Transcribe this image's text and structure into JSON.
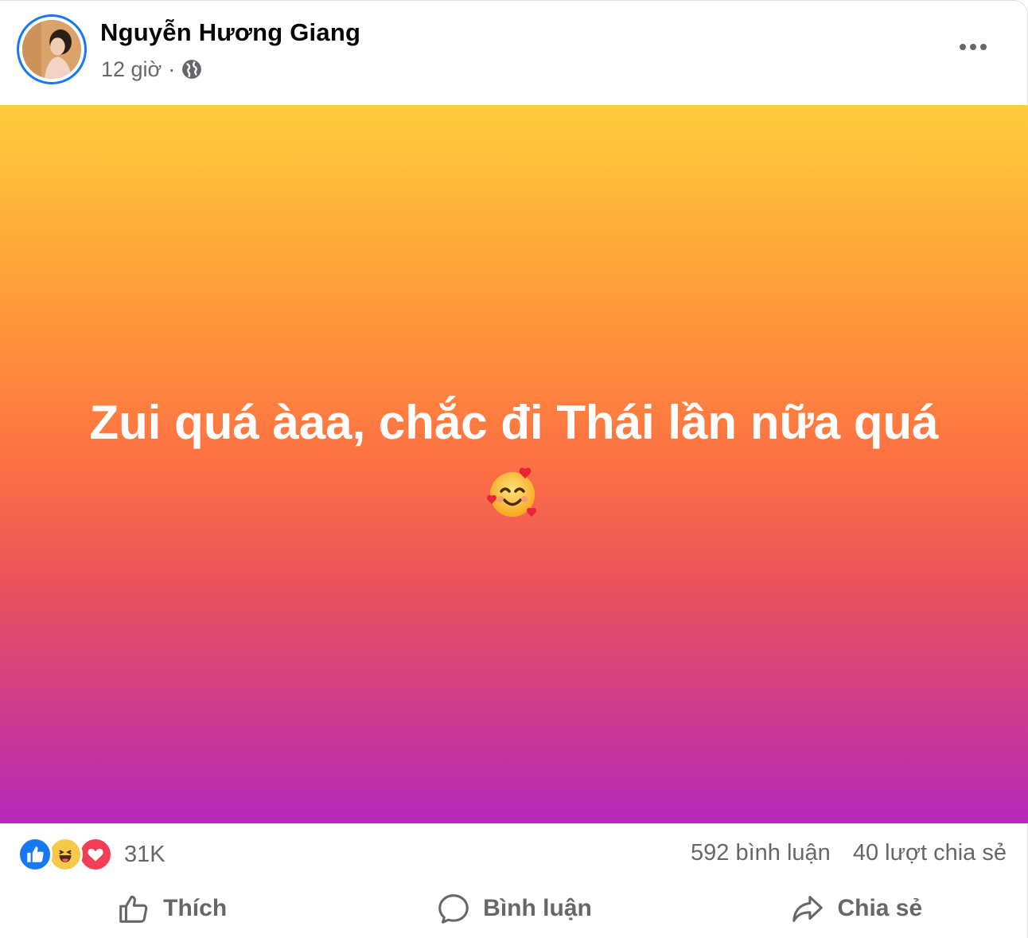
{
  "post": {
    "author": "Nguyễn Hương Giang",
    "time": "12 giờ",
    "separator": "·",
    "privacy_icon": "globe-icon",
    "more_icon": "more-options-icon",
    "text": "Zui quá àaa, chắc đi Thái lần nữa quá",
    "emoji_name": "smiling-face-with-hearts",
    "background_gradient": [
      "#ffcd3c",
      "#fd7043",
      "#b528b9"
    ]
  },
  "stats": {
    "reactions": [
      "like",
      "haha",
      "love"
    ],
    "reaction_count": "31K",
    "comments": "592 bình luận",
    "shares": "40 lượt chia sẻ"
  },
  "actions": {
    "like_label": "Thích",
    "comment_label": "Bình luận",
    "share_label": "Chia sẻ"
  },
  "colors": {
    "accent": "#1877f2",
    "secondary_text": "#65676b",
    "love": "#f33e58",
    "haha": "#f7c94b"
  }
}
